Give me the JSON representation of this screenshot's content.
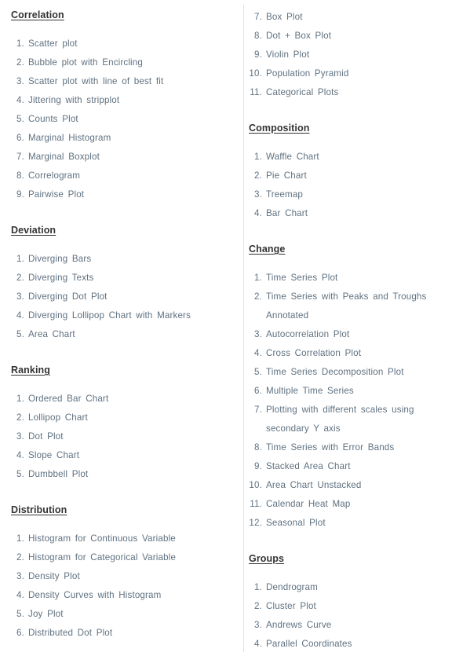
{
  "document": {
    "title": "Top 50 matplotlib Visualizations - Index",
    "text_color": "#5f7180",
    "heading_color": "#333333",
    "divider_color": "#e2e2e2",
    "background": "#ffffff"
  },
  "columns": [
    {
      "name": "left-column",
      "sections": [
        {
          "heading": "Correlation",
          "items": [
            {
              "num": "1.",
              "label": "Scatter plot"
            },
            {
              "num": "2.",
              "label": "Bubble plot with Encircling"
            },
            {
              "num": "3.",
              "label": "Scatter plot with line of best fit"
            },
            {
              "num": "4.",
              "label": "Jittering with stripplot"
            },
            {
              "num": "5.",
              "label": "Counts Plot"
            },
            {
              "num": "6.",
              "label": "Marginal Histogram"
            },
            {
              "num": "7.",
              "label": "Marginal Boxplot"
            },
            {
              "num": "8.",
              "label": "Correlogram"
            },
            {
              "num": "9.",
              "label": "Pairwise Plot"
            }
          ]
        },
        {
          "heading": "Deviation",
          "items": [
            {
              "num": "1.",
              "label": "Diverging Bars"
            },
            {
              "num": "2.",
              "label": "Diverging Texts"
            },
            {
              "num": "3.",
              "label": "Diverging Dot Plot"
            },
            {
              "num": "4.",
              "label": "Diverging Lollipop Chart with Markers"
            },
            {
              "num": "5.",
              "label": "Area Chart"
            }
          ]
        },
        {
          "heading": "Ranking",
          "items": [
            {
              "num": "1.",
              "label": "Ordered Bar Chart"
            },
            {
              "num": "2.",
              "label": "Lollipop Chart"
            },
            {
              "num": "3.",
              "label": "Dot Plot"
            },
            {
              "num": "4.",
              "label": "Slope Chart"
            },
            {
              "num": "5.",
              "label": "Dumbbell Plot"
            }
          ]
        },
        {
          "heading": "Distribution",
          "items": [
            {
              "num": "1.",
              "label": "Histogram for Continuous Variable"
            },
            {
              "num": "2.",
              "label": "Histogram for Categorical Variable"
            },
            {
              "num": "3.",
              "label": "Density Plot"
            },
            {
              "num": "4.",
              "label": "Density Curves with Histogram"
            },
            {
              "num": "5.",
              "label": "Joy Plot"
            },
            {
              "num": "6.",
              "label": "Distributed Dot Plot"
            }
          ]
        }
      ]
    },
    {
      "name": "right-column",
      "sections": [
        {
          "heading": "",
          "items": [
            {
              "num": "7.",
              "label": "Box Plot"
            },
            {
              "num": "8.",
              "label": "Dot + Box Plot"
            },
            {
              "num": "9.",
              "label": "Violin Plot"
            },
            {
              "num": "10.",
              "label": "Population Pyramid"
            },
            {
              "num": "11.",
              "label": "Categorical Plots"
            }
          ]
        },
        {
          "heading": "Composition",
          "items": [
            {
              "num": "1.",
              "label": "Waffle Chart"
            },
            {
              "num": "2.",
              "label": "Pie Chart"
            },
            {
              "num": "3.",
              "label": "Treemap"
            },
            {
              "num": "4.",
              "label": "Bar Chart"
            }
          ]
        },
        {
          "heading": "Change",
          "items": [
            {
              "num": "1.",
              "label": "Time Series Plot"
            },
            {
              "num": "2.",
              "label": "Time Series with Peaks and Troughs Annotated"
            },
            {
              "num": "3.",
              "label": "Autocorrelation Plot"
            },
            {
              "num": "4.",
              "label": "Cross Correlation Plot"
            },
            {
              "num": "5.",
              "label": "Time Series Decomposition Plot"
            },
            {
              "num": "6.",
              "label": "Multiple Time Series"
            },
            {
              "num": "7.",
              "label": "Plotting with different scales using secondary Y axis"
            },
            {
              "num": "8.",
              "label": "Time Series with Error Bands"
            },
            {
              "num": "9.",
              "label": "Stacked Area Chart"
            },
            {
              "num": "10.",
              "label": "Area Chart Unstacked"
            },
            {
              "num": "11.",
              "label": "Calendar Heat Map"
            },
            {
              "num": "12.",
              "label": "Seasonal Plot"
            }
          ]
        },
        {
          "heading": "Groups",
          "items": [
            {
              "num": "1.",
              "label": "Dendrogram"
            },
            {
              "num": "2.",
              "label": "Cluster Plot"
            },
            {
              "num": "3.",
              "label": "Andrews Curve"
            },
            {
              "num": "4.",
              "label": "Parallel Coordinates"
            }
          ]
        }
      ]
    }
  ]
}
